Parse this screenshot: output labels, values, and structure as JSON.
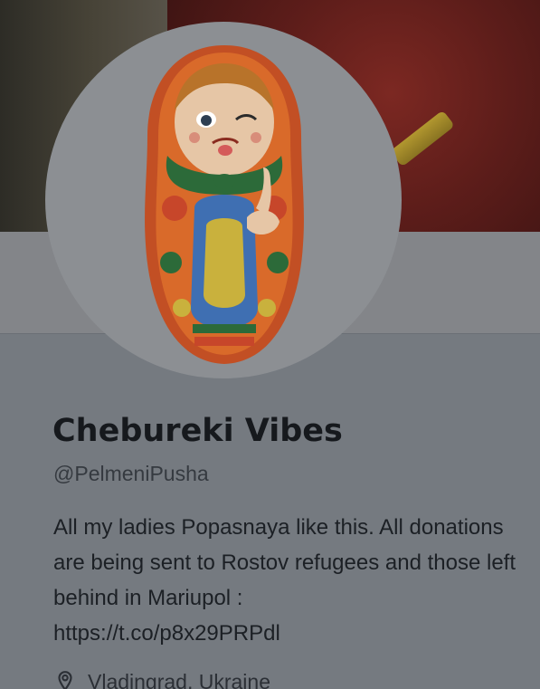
{
  "profile": {
    "display_name": "Chebureki Vibes",
    "handle": "@PelmeniPusha",
    "bio": "All my ladies Popasnaya like this. All donations are being sent to Rostov refugees and those left behind in Mariupol :",
    "bio_link": "https://t.co/p8x29PRPdl",
    "location": "Vladingrad, Ukraine"
  },
  "icons": {
    "location": "location-pin-icon"
  },
  "colors": {
    "overlay_bg": "#7b7f84",
    "text_dark": "#16191d",
    "text_mid": "#2b2f35"
  }
}
